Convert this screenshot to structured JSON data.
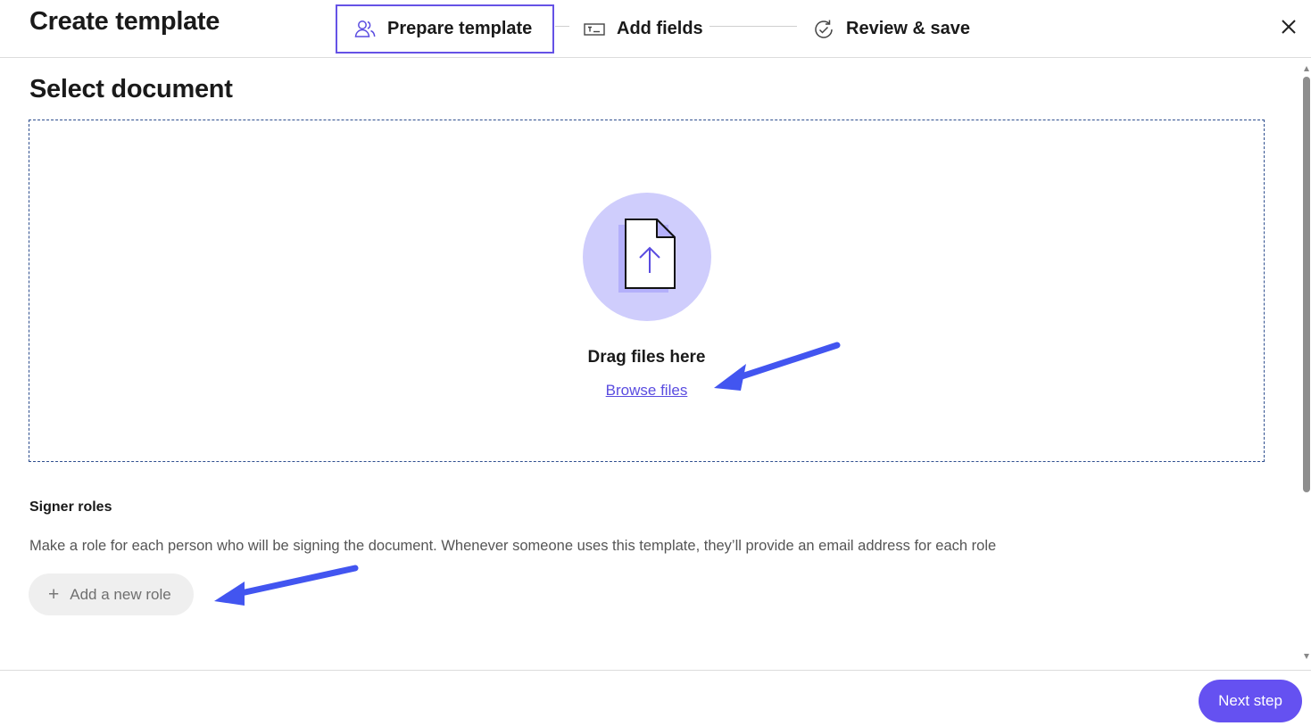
{
  "header": {
    "title": "Create template",
    "steps": [
      {
        "label": "Prepare template",
        "icon": "people-icon",
        "active": true
      },
      {
        "label": "Add fields",
        "icon": "text-field-icon",
        "active": false
      },
      {
        "label": "Review & save",
        "icon": "refresh-check-icon",
        "active": false
      }
    ],
    "close_icon": "close-icon"
  },
  "main": {
    "section_title": "Select document",
    "dropzone": {
      "icon": "file-upload-icon",
      "drag_label": "Drag files here",
      "browse_label": "Browse files"
    },
    "signer_roles": {
      "title": "Signer roles",
      "description": "Make a role for each person who will be signing the document. Whenever someone uses this template, they’ll provide an email address for each role",
      "add_role_label": "Add a new role",
      "add_role_icon": "plus-icon"
    }
  },
  "footer": {
    "next_label": "Next step"
  },
  "colors": {
    "accent": "#6552e6",
    "upload_circle": "#cfcdfc",
    "annotation_arrow": "#4255f0"
  }
}
